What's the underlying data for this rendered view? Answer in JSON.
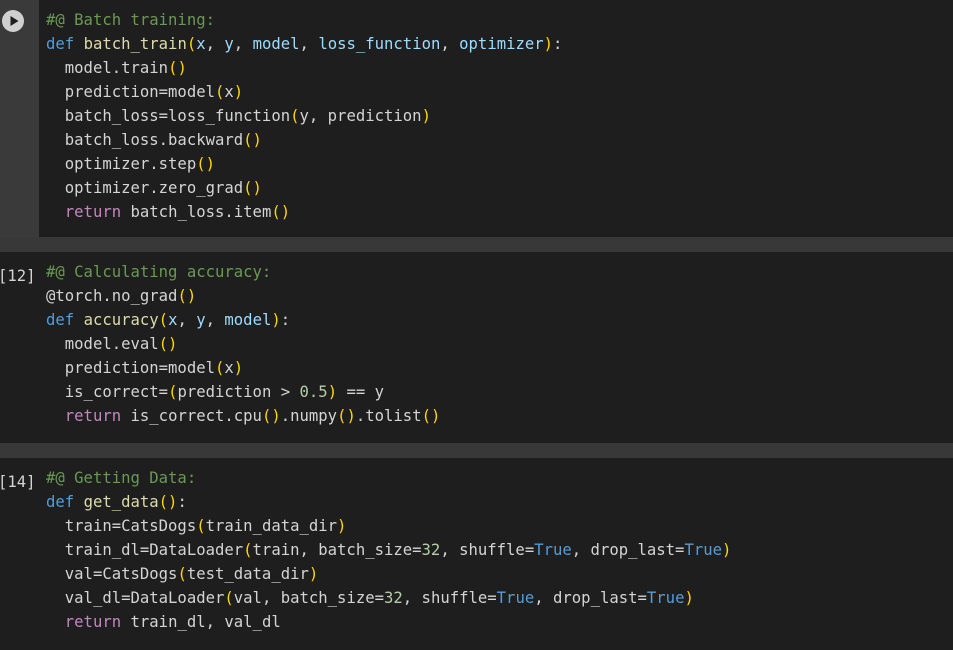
{
  "colors": {
    "background": "#1e1e1e",
    "separator": "#383838",
    "comment": "#6a9955",
    "keyword": "#569cd6",
    "control_keyword": "#c586c0",
    "function": "#dcdcaa",
    "parameter": "#9cdcfe",
    "bracket": "#ffd700",
    "number": "#b5cea8",
    "text": "#d4d4d4"
  },
  "cells": [
    {
      "exec_count": "",
      "has_run_button": true,
      "lines": [
        [
          [
            "cm",
            "#@ Batch training:"
          ]
        ],
        [
          [
            "kw",
            "def"
          ],
          [
            "tx",
            " "
          ],
          [
            "fn",
            "batch_train"
          ],
          [
            "br",
            "("
          ],
          [
            "pm",
            "x"
          ],
          [
            "tx",
            ", "
          ],
          [
            "pm",
            "y"
          ],
          [
            "tx",
            ", "
          ],
          [
            "pm",
            "model"
          ],
          [
            "tx",
            ", "
          ],
          [
            "pm",
            "loss_function"
          ],
          [
            "tx",
            ", "
          ],
          [
            "pm",
            "optimizer"
          ],
          [
            "br",
            ")"
          ],
          [
            "tx",
            ":"
          ]
        ],
        [
          [
            "tx",
            "  model.train"
          ],
          [
            "br",
            "()"
          ]
        ],
        [
          [
            "tx",
            "  prediction=model"
          ],
          [
            "br",
            "("
          ],
          [
            "tx",
            "x"
          ],
          [
            "br",
            ")"
          ]
        ],
        [
          [
            "tx",
            "  batch_loss=loss_function"
          ],
          [
            "br",
            "("
          ],
          [
            "tx",
            "y, prediction"
          ],
          [
            "br",
            ")"
          ]
        ],
        [
          [
            "tx",
            "  batch_loss.backward"
          ],
          [
            "br",
            "()"
          ]
        ],
        [
          [
            "tx",
            "  optimizer.step"
          ],
          [
            "br",
            "()"
          ]
        ],
        [
          [
            "tx",
            "  optimizer.zero_grad"
          ],
          [
            "br",
            "()"
          ]
        ],
        [
          [
            "tx",
            "  "
          ],
          [
            "kw2",
            "return"
          ],
          [
            "tx",
            " batch_loss.item"
          ],
          [
            "br",
            "()"
          ]
        ]
      ]
    },
    {
      "exec_count": "[12]",
      "has_run_button": false,
      "lines": [
        [
          [
            "cm",
            "#@ Calculating accuracy:"
          ]
        ],
        [
          [
            "dec",
            "@torch.no_grad"
          ],
          [
            "br",
            "()"
          ]
        ],
        [
          [
            "kw",
            "def"
          ],
          [
            "tx",
            " "
          ],
          [
            "fn",
            "accuracy"
          ],
          [
            "br",
            "("
          ],
          [
            "pm",
            "x"
          ],
          [
            "tx",
            ", "
          ],
          [
            "pm",
            "y"
          ],
          [
            "tx",
            ", "
          ],
          [
            "pm",
            "model"
          ],
          [
            "br",
            ")"
          ],
          [
            "tx",
            ":"
          ]
        ],
        [
          [
            "tx",
            "  model.eval"
          ],
          [
            "br",
            "()"
          ]
        ],
        [
          [
            "tx",
            "  prediction=model"
          ],
          [
            "br",
            "("
          ],
          [
            "tx",
            "x"
          ],
          [
            "br",
            ")"
          ]
        ],
        [
          [
            "tx",
            "  is_correct="
          ],
          [
            "br",
            "("
          ],
          [
            "tx",
            "prediction > "
          ],
          [
            "nu",
            "0.5"
          ],
          [
            "br",
            ")"
          ],
          [
            "tx",
            " == y"
          ]
        ],
        [
          [
            "tx",
            "  "
          ],
          [
            "kw2",
            "return"
          ],
          [
            "tx",
            " is_correct.cpu"
          ],
          [
            "br",
            "()"
          ],
          [
            "tx",
            ".numpy"
          ],
          [
            "br",
            "()"
          ],
          [
            "tx",
            ".tolist"
          ],
          [
            "br",
            "()"
          ]
        ]
      ]
    },
    {
      "exec_count": "[14]",
      "has_run_button": false,
      "lines": [
        [
          [
            "cm",
            "#@ Getting Data:"
          ]
        ],
        [
          [
            "kw",
            "def"
          ],
          [
            "tx",
            " "
          ],
          [
            "fn",
            "get_data"
          ],
          [
            "br",
            "()"
          ],
          [
            "tx",
            ":"
          ]
        ],
        [
          [
            "tx",
            "  train=CatsDogs"
          ],
          [
            "br",
            "("
          ],
          [
            "tx",
            "train_data_dir"
          ],
          [
            "br",
            ")"
          ]
        ],
        [
          [
            "tx",
            "  train_dl=DataLoader"
          ],
          [
            "br",
            "("
          ],
          [
            "tx",
            "train, batch_size="
          ],
          [
            "nu",
            "32"
          ],
          [
            "tx",
            ", shuffle="
          ],
          [
            "kw",
            "True"
          ],
          [
            "tx",
            ", drop_last="
          ],
          [
            "kw",
            "True"
          ],
          [
            "br",
            ")"
          ]
        ],
        [
          [
            "tx",
            "  val=CatsDogs"
          ],
          [
            "br",
            "("
          ],
          [
            "tx",
            "test_data_dir"
          ],
          [
            "br",
            ")"
          ]
        ],
        [
          [
            "tx",
            "  val_dl=DataLoader"
          ],
          [
            "br",
            "("
          ],
          [
            "tx",
            "val, batch_size="
          ],
          [
            "nu",
            "32"
          ],
          [
            "tx",
            ", shuffle="
          ],
          [
            "kw",
            "True"
          ],
          [
            "tx",
            ", drop_last="
          ],
          [
            "kw",
            "True"
          ],
          [
            "br",
            ")"
          ]
        ],
        [
          [
            "tx",
            "  "
          ],
          [
            "kw2",
            "return"
          ],
          [
            "tx",
            " train_dl, val_dl"
          ]
        ]
      ]
    }
  ]
}
